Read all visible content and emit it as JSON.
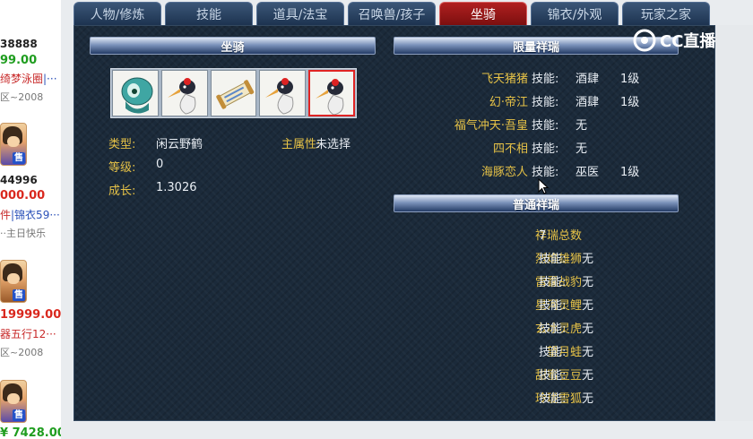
{
  "tabs": [
    {
      "label": "人物/修炼",
      "active": false
    },
    {
      "label": "技能",
      "active": false
    },
    {
      "label": "道具/法宝",
      "active": false
    },
    {
      "label": "召唤兽/孩子",
      "active": false
    },
    {
      "label": "坐骑",
      "active": true
    },
    {
      "label": "锦衣/外观",
      "active": false
    },
    {
      "label": "玩家之家",
      "active": false
    }
  ],
  "listings": [
    {
      "id": "38888",
      "price": "99.00",
      "desc_red": "绮梦泳圈",
      "desc_blue": "|···"
    },
    {
      "zone": "区~2008",
      "id": "44996",
      "price": "000.00",
      "desc_red": "件",
      "desc_blue": "|锦衣59···",
      "extra": "··主日快乐",
      "sell": "售"
    },
    {
      "id": "",
      "price": "19999.00",
      "desc_red": "器五行12···",
      "zone2": "区~2008",
      "sell": "售"
    },
    {
      "price_green": "¥ 7428.00",
      "sell": "售"
    }
  ],
  "mount_section": {
    "title": "坐骑",
    "type_label": "类型:",
    "type_value": "闲云野鹤",
    "main_attr_label": "主属性:",
    "main_attr_value": "未选择",
    "level_label": "等级:",
    "level_value": "0",
    "growth_label": "成长:",
    "growth_value": "1.3026",
    "items": [
      "green-monster-mount",
      "crane-mount",
      "scroll-item",
      "crane-mount",
      "crane-mount"
    ],
    "selected_index": 4
  },
  "rare_section": {
    "title": "限量祥瑞",
    "rows": [
      {
        "name": "飞天猪猪",
        "skill_label": "技能:",
        "skill": "酒肆",
        "level": "1级"
      },
      {
        "name": "幻·帝江",
        "skill_label": "技能:",
        "skill": "酒肆",
        "level": "1级"
      },
      {
        "name": "福气冲天·吾皇",
        "skill_label": "技能:",
        "skill": "无",
        "level": ""
      },
      {
        "name": "四不相",
        "skill_label": "技能:",
        "skill": "无",
        "level": ""
      },
      {
        "name": "海豚恋人",
        "skill_label": "技能:",
        "skill": "巫医",
        "level": "1级"
      }
    ]
  },
  "normal_section": {
    "title": "普通祥瑞",
    "total_label": "祥瑞总数",
    "total_value": "7",
    "rows": [
      {
        "name": "烈焰雄狮",
        "skill_label": "技能:",
        "skill": "无"
      },
      {
        "name": "雷霆战豹",
        "skill_label": "技能:",
        "skill": "无"
      },
      {
        "name": "星河灵鲤",
        "skill_label": "技能:",
        "skill": "无"
      },
      {
        "name": "玄冰灵虎",
        "skill_label": "技能:",
        "skill": "无"
      },
      {
        "name": "望月蛙",
        "skill_label": "技能:",
        "skill": "无"
      },
      {
        "name": "甜蜜豆豆",
        "skill_label": "技能:",
        "skill": "无"
      },
      {
        "name": "玲珑雪狐",
        "skill_label": "技能:",
        "skill": "无"
      }
    ]
  },
  "watermark": {
    "text": "CC直播"
  },
  "colors": {
    "label": "#e6c247",
    "value": "#e9eef4",
    "active_tab": "#b02020",
    "panel": "#1b2a3a"
  }
}
